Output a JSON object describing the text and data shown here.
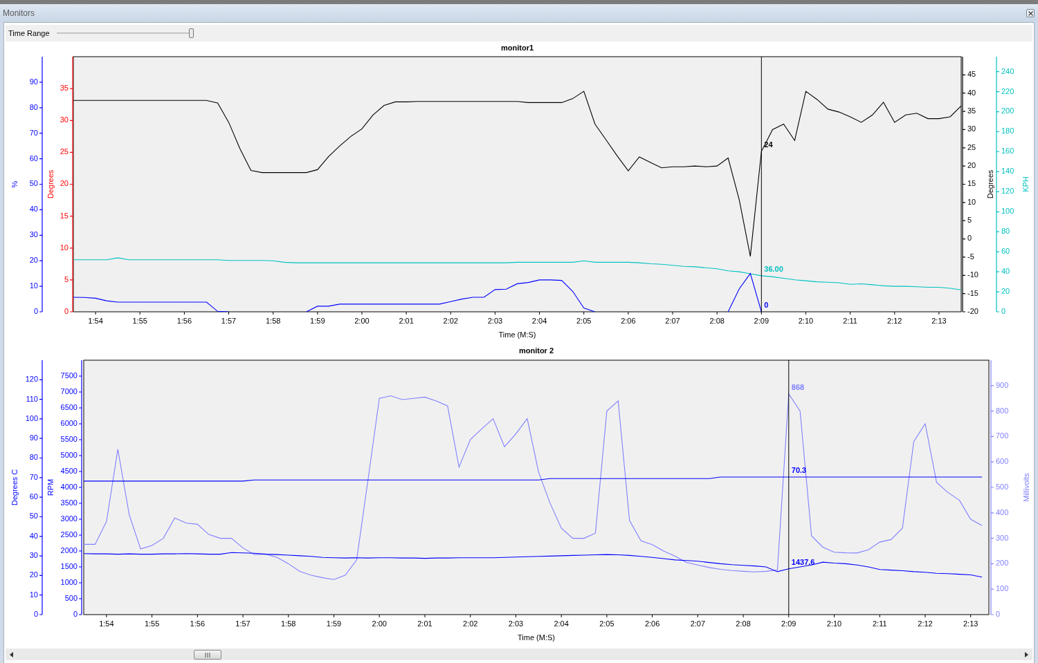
{
  "window": {
    "title": "Monitors"
  },
  "time_range": {
    "label": "Time Range",
    "level": 1
  },
  "monitors": [
    {
      "chart_data": {
        "type": "line",
        "title": "monitor1",
        "xlabel": "Time (M:S)",
        "categories": [
          null,
          null,
          "1:54",
          null,
          null,
          null,
          "1:55",
          null,
          null,
          null,
          "1:56",
          null,
          null,
          null,
          "1:57",
          null,
          null,
          null,
          "1:58",
          null,
          null,
          null,
          "1:59",
          null,
          null,
          null,
          "2:00",
          null,
          null,
          null,
          "2:01",
          null,
          null,
          null,
          "2:02",
          null,
          null,
          null,
          "2:03",
          null,
          null,
          null,
          "2:04",
          null,
          null,
          null,
          "2:05",
          null,
          null,
          null,
          "2:06",
          null,
          null,
          null,
          "2:07",
          null,
          null,
          null,
          "2:08",
          null,
          null,
          null,
          "2:09",
          null,
          null,
          null,
          "2:10",
          null,
          null,
          null,
          "2:11",
          null,
          null,
          null,
          "2:12",
          null,
          null,
          null,
          "2:13",
          null,
          null
        ],
        "ylabel": "%",
        "ylim": [
          0,
          100
        ],
        "yticks": [
          0,
          10,
          20,
          30,
          40,
          50,
          60,
          70,
          80,
          90
        ],
        "y2label": "Degrees",
        "y2lim": [
          -20,
          50
        ],
        "y2ticks": [
          -20,
          -15,
          -10,
          -5,
          0,
          5,
          10,
          15,
          20,
          25,
          30,
          35,
          40,
          45
        ],
        "y3label": "KPH",
        "y3lim": [
          0,
          255
        ],
        "y3ticks": [
          0,
          20,
          40,
          60,
          80,
          100,
          120,
          140,
          160,
          180,
          200,
          220,
          240
        ],
        "series": [
          {
            "color": "#000000",
            "axis": "y2",
            "values": [
              38,
              38,
              38,
              38,
              38,
              38,
              38,
              38,
              38,
              38,
              38,
              38,
              38,
              37.3,
              32,
              24.8,
              18.8,
              18.2,
              18.2,
              18.2,
              18.2,
              18.2,
              19,
              22.6,
              25.5,
              28.1,
              30.2,
              34,
              36.6,
              37.6,
              37.6,
              37.7,
              37.7,
              37.7,
              37.7,
              37.7,
              37.7,
              37.7,
              37.7,
              37.7,
              37.7,
              37.4,
              37.4,
              37.4,
              37.4,
              38.5,
              40.5,
              31.5,
              27.2,
              22.8,
              18.7,
              22.5,
              21,
              19.5,
              19.8,
              19.8,
              20,
              19.8,
              20,
              22.2,
              10.7,
              -4.8,
              24,
              30,
              31.5,
              27,
              40.5,
              38.3,
              35.6,
              34.8,
              33.5,
              32,
              34,
              37.5,
              32,
              34,
              34.5,
              33,
              33,
              33.5,
              36.5
            ]
          },
          {
            "color": "#00c0c0",
            "axis": "y3",
            "values": [
              52,
              52,
              52,
              52,
              54,
              52,
              52,
              52,
              52,
              52,
              52,
              52,
              52,
              52,
              51.3,
              51.3,
              51.3,
              51.3,
              51,
              49.5,
              49,
              49,
              49,
              49,
              49,
              49,
              49,
              49,
              49,
              49,
              49,
              49,
              49,
              49,
              49,
              49,
              49,
              49,
              49,
              49,
              49.5,
              49.5,
              49.5,
              49.5,
              49.5,
              49.5,
              51,
              49.5,
              49.5,
              49.5,
              49.5,
              49,
              48,
              47.5,
              46.5,
              45.5,
              45,
              44,
              43,
              41,
              40,
              38,
              36,
              35,
              33.5,
              32,
              31,
              30,
              29.5,
              29,
              27.5,
              28,
              27,
              26,
              25.5,
              25.5,
              25,
              24.5,
              24.5,
              23.5,
              22
            ]
          },
          {
            "color": "#0000ff",
            "values": [
              5.7,
              5.6,
              5.3,
              4.3,
              3.8,
              3.8,
              3.8,
              3.8,
              3.8,
              3.8,
              3.8,
              3.8,
              3.8,
              0.2,
              0,
              null,
              null,
              null,
              null,
              null,
              null,
              0,
              2.2,
              2.2,
              3,
              3,
              3,
              3,
              3,
              3,
              3,
              3,
              3,
              3,
              4,
              5,
              5.7,
              5.7,
              8.7,
              8.9,
              11,
              11.5,
              12.5,
              12.5,
              12.3,
              8,
              1.5,
              0,
              null,
              null,
              null,
              null,
              null,
              null,
              null,
              null,
              null,
              null,
              null,
              0,
              9,
              15,
              0,
              null,
              null,
              null,
              null,
              null,
              null,
              null,
              null,
              null,
              null,
              null,
              null,
              null,
              null,
              null,
              null,
              null,
              null
            ]
          }
        ]
      },
      "extra_axis": {
        "label": "Degrees",
        "color": "#ff0000",
        "ticks": [
          "35",
          "30",
          "25",
          "20",
          "15",
          "10",
          "5",
          "0"
        ]
      },
      "cursor_readings": [
        "24",
        "36.00",
        "0"
      ]
    },
    {
      "chart_data": {
        "type": "line",
        "title": "monitor 2",
        "xlabel": "Time (M:S)",
        "categories": [
          null,
          null,
          "1:54",
          null,
          null,
          null,
          "1:55",
          null,
          null,
          null,
          "1:56",
          null,
          null,
          null,
          "1:57",
          null,
          null,
          null,
          "1:58",
          null,
          null,
          null,
          "1:59",
          null,
          null,
          null,
          "2:00",
          null,
          null,
          null,
          "2:01",
          null,
          null,
          null,
          "2:02",
          null,
          null,
          null,
          "2:03",
          null,
          null,
          null,
          "2:04",
          null,
          null,
          null,
          "2:05",
          null,
          null,
          null,
          "2:06",
          null,
          null,
          null,
          "2:07",
          null,
          null,
          null,
          "2:08",
          null,
          null,
          null,
          "2:09",
          null,
          null,
          null,
          "2:10",
          null,
          null,
          null,
          "2:11",
          null,
          null,
          null,
          "2:12",
          null,
          null,
          null,
          "2:13",
          null
        ],
        "ylabel": "Degrees C",
        "ylim": [
          0,
          130
        ],
        "yticks": [
          0,
          10,
          20,
          30,
          40,
          50,
          60,
          70,
          80,
          90,
          100,
          110,
          120
        ],
        "y2label": "RPM",
        "y2lim": [
          0,
          8000
        ],
        "y2ticks": [
          0,
          500,
          1000,
          1500,
          2000,
          2500,
          3000,
          3500,
          4000,
          4500,
          5000,
          5500,
          6000,
          6500,
          7000,
          7500
        ],
        "y3label": "Millivolts",
        "y3lim": [
          0,
          1000
        ],
        "y3ticks": [
          0,
          100,
          200,
          300,
          400,
          500,
          600,
          700,
          800,
          900
        ],
        "series": [
          {
            "color": "#8080ff",
            "axis": "y3",
            "values": [
              276,
              276,
              366,
              650,
              393,
              258,
              272,
              300,
              380,
              360,
              355,
              315,
              300,
              300,
              262,
              236,
              238,
              225,
              200,
              170,
              155,
              145,
              138,
              155,
              215,
              530,
              850,
              860,
              845,
              850,
              855,
              840,
              820,
              580,
              688,
              730,
              770,
              660,
              710,
              770,
              560,
              439,
              340,
              300,
              300,
              320,
              800,
              840,
              370,
              290,
              275,
              250,
              230,
              205,
              195,
              185,
              178,
              173,
              170,
              168,
              170,
              175,
              868,
              800,
              310,
              265,
              245,
              243,
              242,
              255,
              285,
              295,
              340,
              680,
              750,
              520,
              480,
              450,
              375,
              350
            ]
          },
          {
            "color": "#0000ff",
            "values": [
              68.2,
              68.2,
              68.2,
              68.2,
              68.2,
              68.2,
              68.2,
              68.2,
              68.2,
              68.2,
              68.2,
              68.2,
              68.2,
              68.2,
              68.2,
              68.8,
              68.8,
              68.8,
              68.8,
              68.8,
              68.8,
              68.8,
              68.8,
              68.8,
              68.8,
              68.8,
              68.8,
              68.8,
              68.8,
              68.8,
              68.8,
              68.8,
              68.8,
              68.8,
              68.8,
              68.8,
              68.8,
              68.8,
              68.8,
              68.8,
              68.8,
              69.5,
              69.5,
              69.5,
              69.5,
              69.5,
              69.5,
              69.5,
              69.5,
              69.5,
              69.5,
              69.5,
              69.5,
              69.5,
              69.5,
              69.5,
              70.3,
              70.3,
              70.3,
              70.3,
              70.3,
              70.3,
              70.3,
              70.3,
              70.3,
              70.3,
              70.3,
              70.3,
              70.3,
              70.3,
              70.3,
              70.3,
              70.3,
              70.3,
              70.3,
              70.3,
              70.3,
              70.3,
              70.3,
              70.3
            ]
          },
          {
            "color": "#0000ff",
            "axis": "y2",
            "values": [
              1920,
              1910,
              1910,
              1900,
              1910,
              1900,
              1900,
              1910,
              1910,
              1920,
              1910,
              1900,
              1900,
              1950,
              1940,
              1930,
              1900,
              1890,
              1870,
              1850,
              1830,
              1800,
              1790,
              1780,
              1790,
              1780,
              1790,
              1790,
              1780,
              1780,
              1770,
              1780,
              1780,
              1790,
              1790,
              1790,
              1790,
              1800,
              1810,
              1820,
              1830,
              1840,
              1850,
              1860,
              1870,
              1880,
              1890,
              1880,
              1860,
              1830,
              1800,
              1760,
              1720,
              1700,
              1680,
              1640,
              1600,
              1570,
              1550,
              1530,
              1500,
              1350,
              1440,
              1500,
              1560,
              1650,
              1620,
              1600,
              1560,
              1500,
              1420,
              1400,
              1380,
              1350,
              1330,
              1300,
              1290,
              1270,
              1250,
              1180
            ]
          }
        ]
      },
      "cursor_readings": [
        "868",
        "70.3",
        "1437.6"
      ]
    }
  ]
}
